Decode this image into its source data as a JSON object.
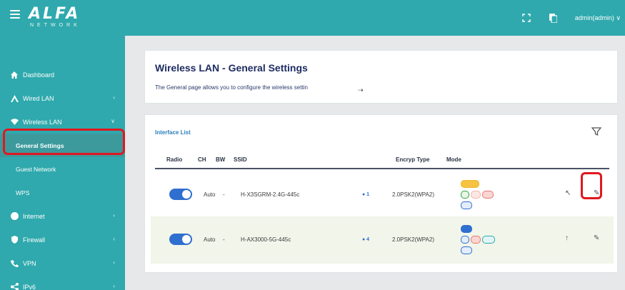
{
  "topbar": {
    "logo_text": "ALFA",
    "logo_subtext": "NETWORK",
    "icons": [
      "fullscreen-icon",
      "document-icon"
    ],
    "user": "admin(admin) ∨"
  },
  "sidebar": {
    "items": [
      {
        "label": "Dashboard",
        "icon": "home-icon"
      },
      {
        "label": "Wired LAN",
        "icon": "network-icon",
        "chevron": "‹"
      },
      {
        "label": "Wireless LAN",
        "icon": "wifi-icon",
        "chevron": "∨"
      },
      {
        "label": "General Settings",
        "active": true
      },
      {
        "label": "Guest Network"
      },
      {
        "label": "WPS"
      },
      {
        "label": "Internet",
        "icon": "globe-icon",
        "chevron": "‹"
      },
      {
        "label": "Firewall",
        "icon": "shield-icon",
        "chevron": "‹"
      },
      {
        "label": "VPN",
        "icon": "vpn-icon",
        "chevron": "‹"
      },
      {
        "label": "IPv6",
        "icon": "share-icon",
        "chevron": "‹"
      }
    ]
  },
  "header": {
    "title": "Wireless LAN - General Settings",
    "description": "The General page allows you to configure the wireless settin"
  },
  "interfaces": {
    "section_title": "Interface List",
    "columns": [
      "Radio",
      "CH",
      "BW",
      "SSID",
      "Encryp Type",
      "Mode"
    ],
    "rows": [
      {
        "ch": "Auto",
        "bw": "-",
        "ssid": "H-X3SGRM-2.4G-445c",
        "status": "● 1",
        "encryption": "2.0PSK2(WPA2)",
        "enabled": true
      },
      {
        "ch": "Auto",
        "bw": "-",
        "ssid": "H-AX3000-5G-445c",
        "status": "● 4",
        "encryption": "2.0PSK2(WPA2)",
        "enabled": true
      }
    ]
  },
  "colors": {
    "accent": "#2fa9ad",
    "title": "#1e2c62",
    "highlight": "#e1171f",
    "toggle": "#2f6fd0"
  }
}
